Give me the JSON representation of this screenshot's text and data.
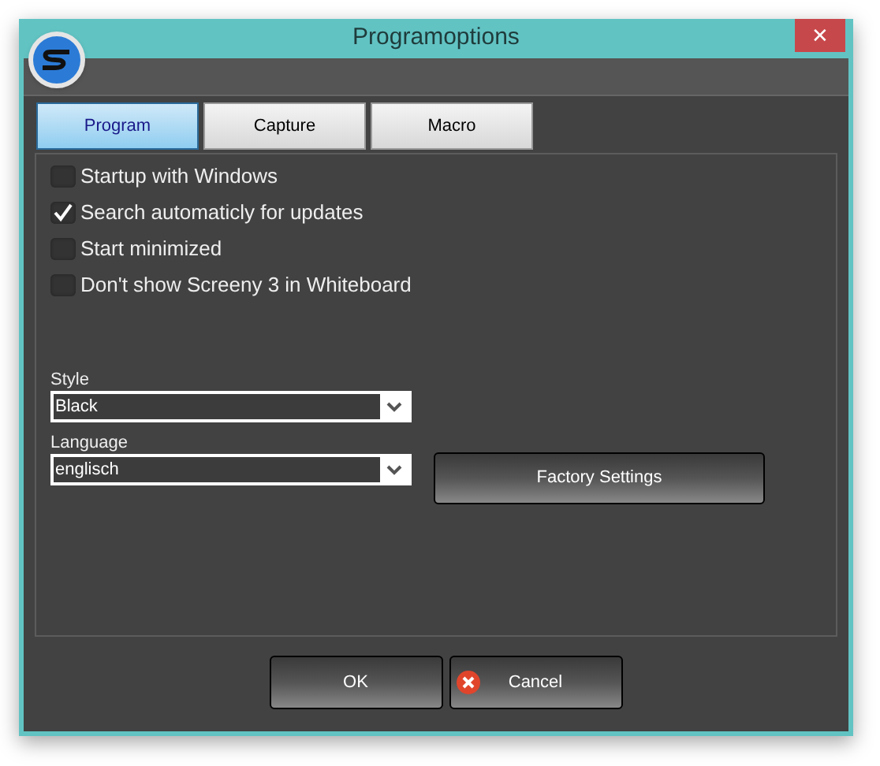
{
  "window": {
    "title": "Programoptions",
    "close": "✕"
  },
  "tabs": [
    {
      "label": "Program",
      "selected": true
    },
    {
      "label": "Capture",
      "selected": false
    },
    {
      "label": "Macro",
      "selected": false
    }
  ],
  "options": [
    {
      "label": "Startup with Windows",
      "checked": false
    },
    {
      "label": "Search automaticly for updates",
      "checked": true
    },
    {
      "label": "Start minimized",
      "checked": false
    },
    {
      "label": "Don't show Screeny 3 in Whiteboard",
      "checked": false
    }
  ],
  "style": {
    "label": "Style",
    "value": "Black"
  },
  "language": {
    "label": "Language",
    "value": "englisch"
  },
  "factory_button": "Factory Settings",
  "buttons": [
    {
      "label": "OK",
      "kind": "ok"
    },
    {
      "label": "Cancel",
      "kind": "cancel"
    }
  ]
}
